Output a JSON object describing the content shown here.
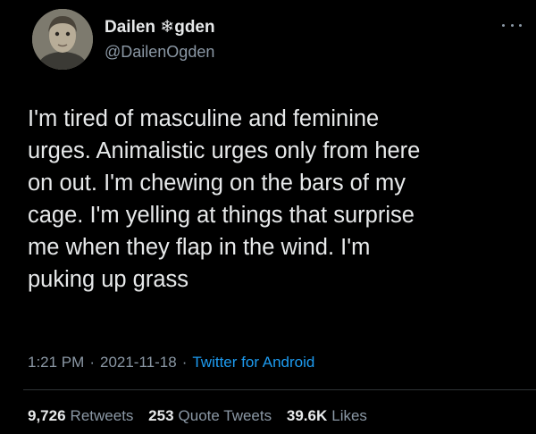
{
  "tweet": {
    "author": {
      "display_name": "Dailen ❄gden",
      "handle": "@DailenOgden"
    },
    "text_lines": [
      "I'm tired of masculine and feminine",
      "urges. Animalistic urges only from here",
      "on out. I'm chewing on the bars of my",
      "cage. I'm yelling at things that surprise",
      "me when they flap in the wind. I'm",
      "puking up grass"
    ],
    "time": "1:21 PM",
    "date": "2021-11-18",
    "separator": "·",
    "source": "Twitter for Android",
    "stats": {
      "retweets_count": "9,726",
      "retweets_label": "Retweets",
      "quotes_count": "253",
      "quotes_label": "Quote Tweets",
      "likes_count": "39.6K",
      "likes_label": "Likes"
    },
    "more_icon": "more-horizontal-icon"
  },
  "colors": {
    "background": "#000000",
    "primary_text": "#e7e9ea",
    "secondary_text": "#8b98a5",
    "link": "#1d9bf0",
    "divider": "#2f3336"
  }
}
